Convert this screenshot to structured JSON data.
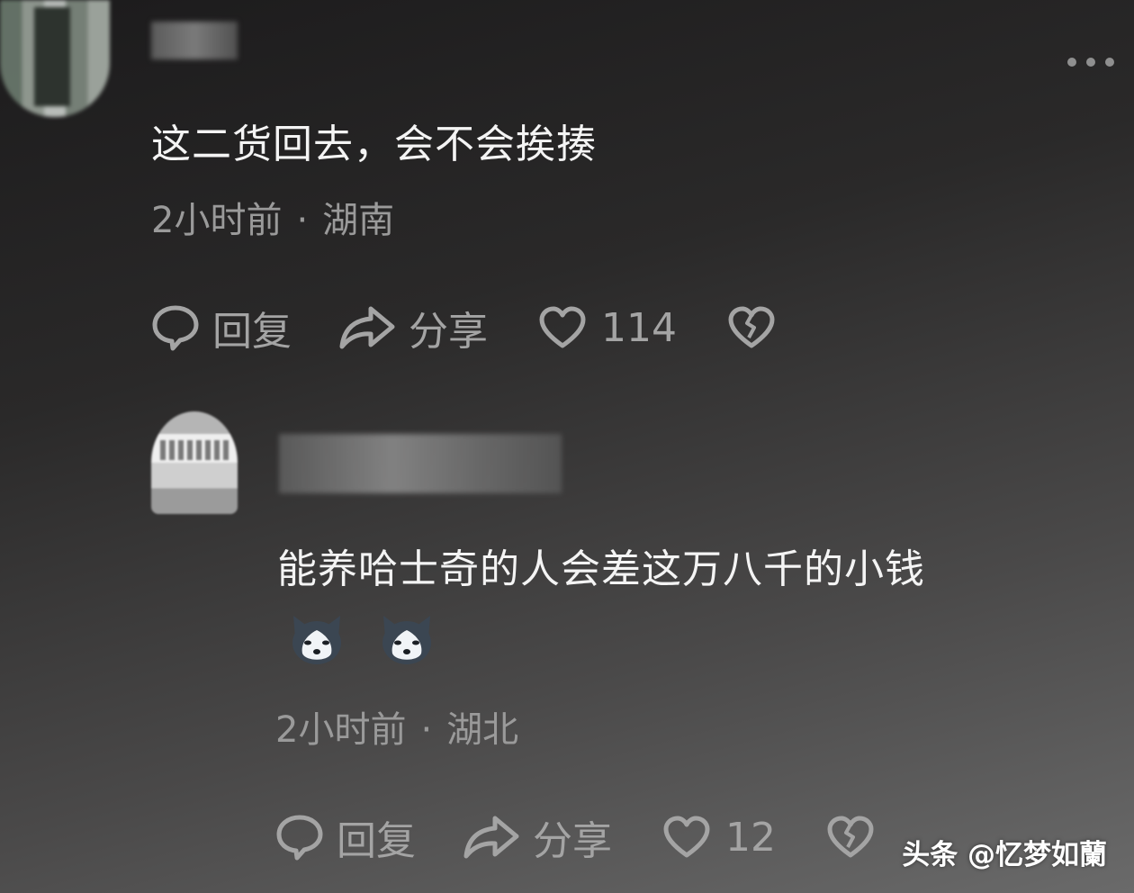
{
  "comments": [
    {
      "text": "这二货回去，会不会挨揍",
      "time": "2小时前",
      "sep": "·",
      "location": "湖南",
      "reply_label": "回复",
      "share_label": "分享",
      "like_count": "114"
    },
    {
      "text": "能养哈士奇的人会差这万八千的小钱",
      "emojis": [
        "husky-emoji",
        "husky-emoji"
      ],
      "time": "2小时前",
      "sep": "·",
      "location": "湖北",
      "reply_label": "回复",
      "share_label": "分享",
      "like_count": "12"
    }
  ],
  "watermark": "头条 @忆梦如蘭",
  "colors": {
    "text_primary": "#f4f4f4",
    "text_secondary": "#9a9a9a",
    "icon": "#a4a4a4"
  },
  "icons": [
    "comment-bubble-icon",
    "share-arrow-icon",
    "heart-icon",
    "broken-heart-icon",
    "more-dots-icon"
  ]
}
